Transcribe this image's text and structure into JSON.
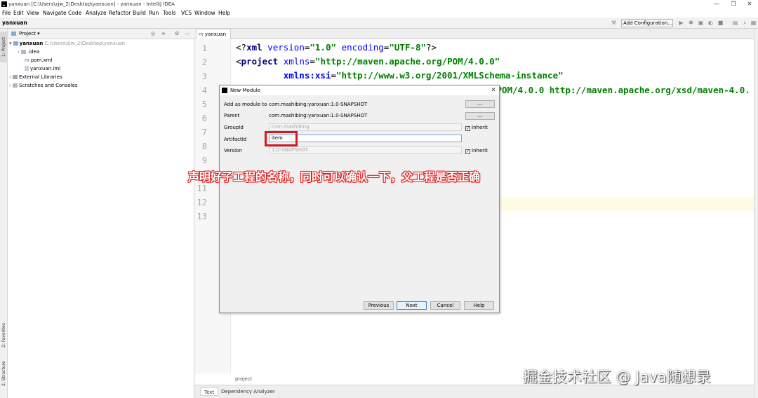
{
  "window": {
    "title": "yanxuan [C:\\Users\\zjw_2\\Desktop\\yanxuan] - yanxuan - IntelliJ IDEA",
    "min": "—",
    "max": "❐",
    "close": "✕"
  },
  "menu": [
    "File",
    "Edit",
    "View",
    "Navigate",
    "Code",
    "Analyze",
    "Refactor",
    "Build",
    "Run",
    "Tools",
    "VCS",
    "Window",
    "Help"
  ],
  "navbar": {
    "crumb": "yanxuan",
    "add_config": "Add Configuration..."
  },
  "side_tabs": {
    "project": "1: Project",
    "favorites": "2: Favorites",
    "structure": "2: Structure"
  },
  "project_panel": {
    "header": "Project ▾",
    "tree": [
      {
        "label": "yanxuan",
        "path": "C:\\Users\\zjw_2\\Desktop\\yanxuan"
      },
      {
        "label": ".idea"
      },
      {
        "label": "pom.xml"
      },
      {
        "label": "yanxuan.iml"
      },
      {
        "label": "External Libraries"
      },
      {
        "label": "Scratches and Consoles"
      }
    ]
  },
  "editor": {
    "tab": "yanxuan",
    "line_numbers": [
      "1",
      "2",
      "3",
      "4",
      "5",
      "6",
      "7",
      "8",
      "9",
      "10",
      "11",
      "12",
      "13"
    ],
    "line1": {
      "a": "<?",
      "b": "xml ",
      "c": "version",
      "d": "=",
      "e": "\"1.0\"",
      "f": " ",
      "g": "encoding",
      "h": "=",
      "i": "\"UTF-8\"",
      "j": "?>"
    },
    "line2": {
      "a": "<",
      "b": "project ",
      "c": "xmlns",
      "d": "=",
      "e": "\"http://maven.apache.org/POM/4.0.0\""
    },
    "line3": {
      "a": "         xmlns:xsi",
      "b": "=",
      "c": "\"http://www.w3.org/2001/XMLSchema-instance\""
    },
    "line4": {
      "a": "/POM/4.0.0 http://maven.apache.org/xsd/maven-4.0."
    },
    "breadcrumb": "project"
  },
  "bottom_tabs": [
    "Text",
    "Dependency Analyzer"
  ],
  "dialog": {
    "title": "New Module",
    "close": "✕",
    "add_as_module_label": "Add as module to",
    "add_as_module_value": "com.mashibing:yanxuan:1.0-SNAPSHOT",
    "parent_label": "Parent",
    "parent_value": "com.mashibing:yanxuan:1.0-SNAPSHOT",
    "ellipsis": "...",
    "groupid_label": "GroupId",
    "groupid_value": "com.mashibing",
    "artifactid_label": "ArtifactId",
    "artifactid_value": "item",
    "version_label": "Version",
    "version_value": "1.0-SNAPSHOT",
    "inherit": "Inherit",
    "buttons": {
      "previous": "Previous",
      "next": "Next",
      "cancel": "Cancel",
      "help": "Help"
    }
  },
  "annotation": "声明好子工程的名称，同时可以确认一下，父工程是否正确",
  "watermark": "掘金技术社区 @ Java随想录",
  "colors": {
    "annotation": "#e0201e",
    "highlight": "#d8181d"
  }
}
